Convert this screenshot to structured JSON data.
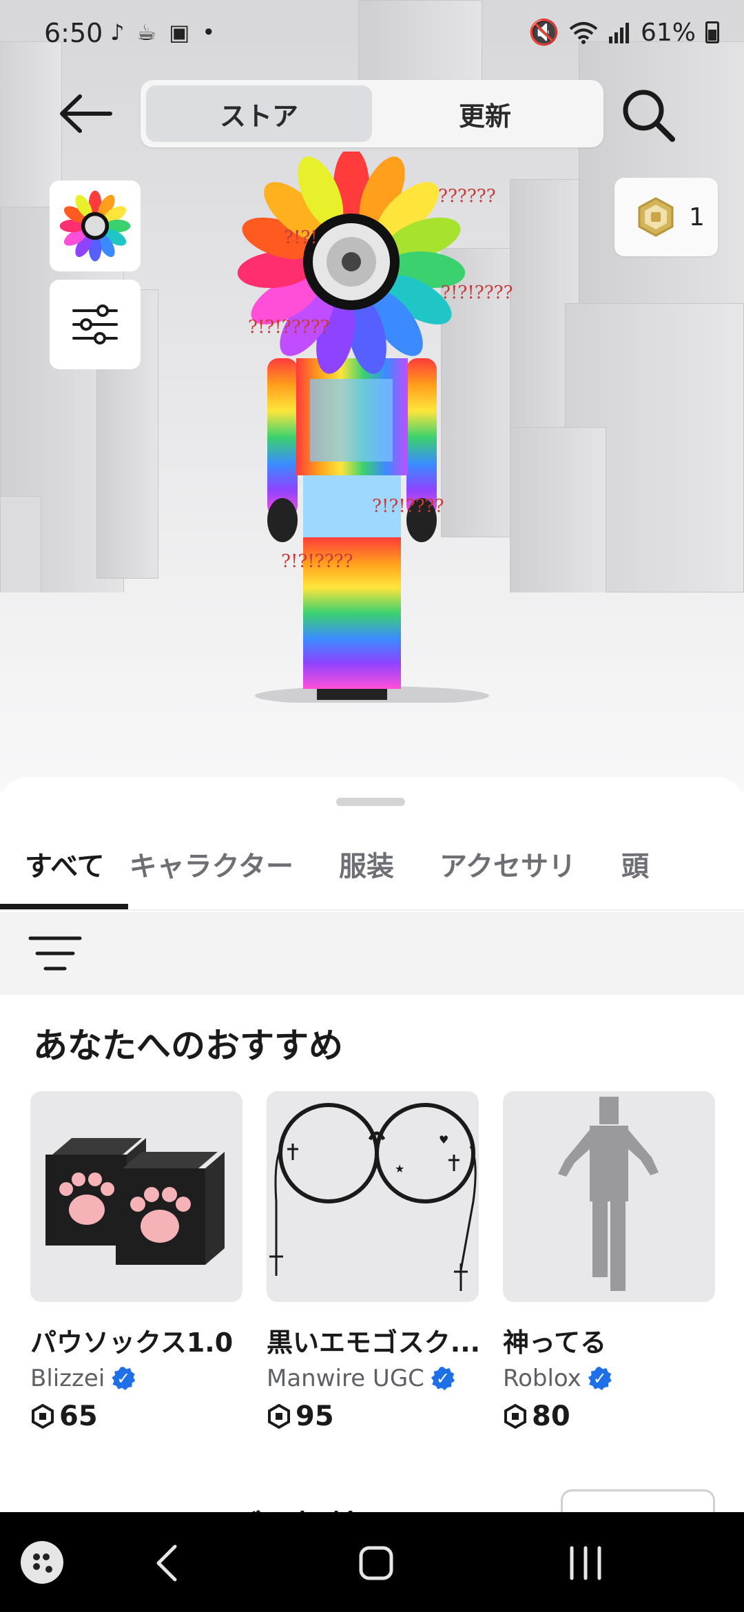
{
  "status_bar": {
    "time": "6:50",
    "battery": "61%"
  },
  "header": {
    "segments": [
      {
        "label": "ストア",
        "active": true
      },
      {
        "label": "更新",
        "active": false
      }
    ]
  },
  "robux": {
    "count": "1"
  },
  "sheet": {
    "tabs": [
      {
        "label": "すべて",
        "active": true
      },
      {
        "label": "キャラクター",
        "active": false
      },
      {
        "label": "服装",
        "active": false
      },
      {
        "label": "アクセサリ",
        "active": false
      },
      {
        "label": "頭",
        "active": false
      }
    ],
    "section_title": "あなたへのおすすめ",
    "items": [
      {
        "name": "パウソックス1.0",
        "creator": "Blizzei",
        "verified": true,
        "price": "65",
        "icon": "paw-socks-image"
      },
      {
        "name": "黒いエモゴスク...",
        "creator": "Manwire UGC",
        "verified": true,
        "price": "95",
        "icon": "goth-glasses-image"
      },
      {
        "name": "神ってる",
        "creator": "Roblox",
        "verified": true,
        "price": "80",
        "icon": "emote-figure-image"
      }
    ],
    "next_section_title": "ティー・・・ブを探検する"
  },
  "avatar_text": [
    "??????",
    "?!?!",
    "?!?!????",
    "?!?!?????",
    "?!?!????",
    "?!?!????"
  ],
  "colors": {
    "accent_verified": "#1e6fe8",
    "tab_active": "#1a1a1a",
    "tab_inactive": "#6d6f75"
  }
}
